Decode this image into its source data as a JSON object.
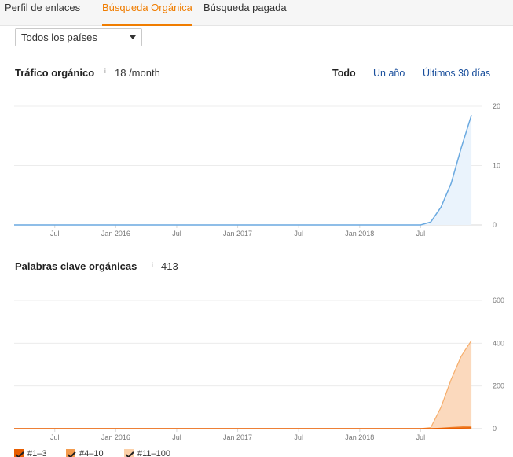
{
  "tabs": [
    {
      "label": "Perfil de enlaces",
      "active": false
    },
    {
      "label": "Búsqueda Orgánica",
      "active": true
    },
    {
      "label": "Búsqueda pagada",
      "active": false
    }
  ],
  "country_select": {
    "value": "Todos los países"
  },
  "traffic": {
    "title": "Tráfico orgánico",
    "info": "i",
    "metric": "18 /month"
  },
  "ranges": [
    {
      "label": "Todo",
      "active": true
    },
    {
      "label": "Un año",
      "active": false
    },
    {
      "label": "Últimos 30 días",
      "active": false
    }
  ],
  "keywords": {
    "title": "Palabras clave orgánicas",
    "info": "i",
    "metric": "413"
  },
  "legend": [
    {
      "label": "#1–3",
      "color": "#e85d00",
      "checked": true
    },
    {
      "label": "#4–10",
      "color": "#f39b4d",
      "checked": true
    },
    {
      "label": "#11–100",
      "color": "#fbd0a8",
      "checked": true
    }
  ],
  "colors": {
    "accent": "#f07d00",
    "traffic_line": "#6aa9e0",
    "traffic_fill": "#eaf3fc",
    "keywords_fill": "#fbd9bd",
    "keywords_line": "#f6ad6a",
    "keywords_top": "#e85d00"
  },
  "chart_data": [
    {
      "type": "area",
      "title": "Tráfico orgánico",
      "x_tick_labels": [
        "Jul",
        "Jan 2016",
        "Jul",
        "Jan 2017",
        "Jul",
        "Jan 2018",
        "Jul"
      ],
      "x": [
        "2015-07",
        "2016-01",
        "2016-07",
        "2017-01",
        "2017-07",
        "2018-01",
        "2018-07",
        "2018-08",
        "2018-09",
        "2018-10",
        "2018-11",
        "2018-12"
      ],
      "y_ticks": [
        0,
        10,
        20
      ],
      "ylim": [
        0,
        20
      ],
      "series": [
        {
          "values": [
            0,
            0,
            0,
            0,
            0,
            0,
            0,
            0.5,
            3,
            7,
            13,
            18.5
          ]
        }
      ],
      "grid": true
    },
    {
      "type": "area",
      "title": "Palabras clave orgánicas",
      "x_tick_labels": [
        "Jul",
        "Jan 2016",
        "Jul",
        "Jan 2017",
        "Jul",
        "Jan 2018",
        "Jul"
      ],
      "x": [
        "2015-07",
        "2016-01",
        "2016-07",
        "2017-01",
        "2017-07",
        "2018-01",
        "2018-07",
        "2018-08",
        "2018-09",
        "2018-10",
        "2018-11",
        "2018-12"
      ],
      "y_ticks": [
        0,
        200,
        400,
        600
      ],
      "ylim": [
        0,
        600
      ],
      "series": [
        {
          "name": "#11–100",
          "values": [
            0,
            0,
            0,
            0,
            0,
            0,
            0,
            5,
            100,
            230,
            340,
            413
          ]
        },
        {
          "name": "#4–10",
          "values": [
            0,
            0,
            0,
            0,
            0,
            0,
            0,
            0,
            3,
            6,
            9,
            12
          ]
        },
        {
          "name": "#1–3",
          "values": [
            0,
            0,
            0,
            0,
            0,
            0,
            0,
            0,
            1,
            2,
            3,
            4
          ]
        }
      ],
      "grid": true
    }
  ]
}
